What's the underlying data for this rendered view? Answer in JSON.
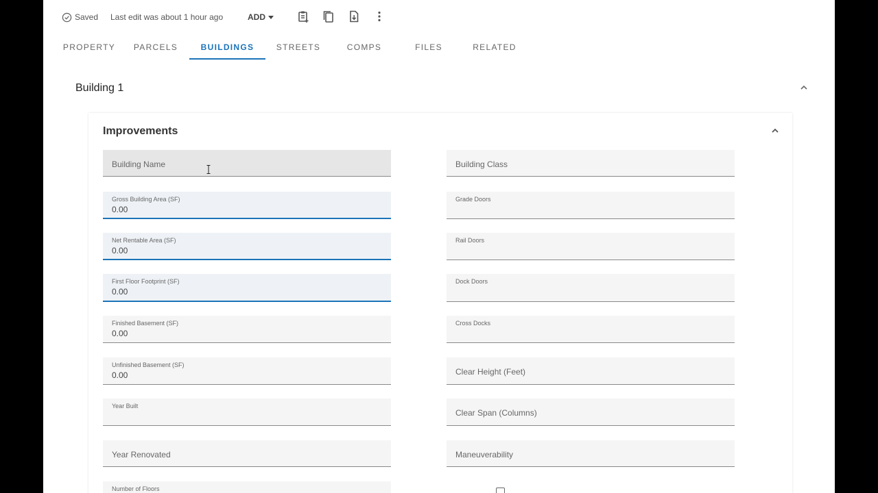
{
  "toolbar": {
    "saved_label": "Saved",
    "last_edit": "Last edit was about 1 hour ago",
    "add_label": "ADD"
  },
  "tabs": [
    {
      "label": "PROPERTY"
    },
    {
      "label": "PARCELS"
    },
    {
      "label": "BUILDINGS",
      "active": true
    },
    {
      "label": "STREETS"
    },
    {
      "label": "COMPS"
    },
    {
      "label": "FILES"
    },
    {
      "label": "RELATED"
    }
  ],
  "building": {
    "title": "Building 1"
  },
  "improvements": {
    "title": "Improvements",
    "left_fields": [
      {
        "label": "Building Name",
        "value": ""
      },
      {
        "label": "Gross Building Area (SF)",
        "value": "0.00"
      },
      {
        "label": "Net Rentable Area (SF)",
        "value": "0.00"
      },
      {
        "label": "First Floor Footprint (SF)",
        "value": "0.00"
      },
      {
        "label": "Finished Basement (SF)",
        "value": "0.00"
      },
      {
        "label": "Unfinished Basement (SF)",
        "value": "0.00"
      },
      {
        "label": "Year Built",
        "value": ""
      },
      {
        "label": "Year Renovated",
        "value": ""
      },
      {
        "label": "Number of Floors",
        "value": ""
      }
    ],
    "right_fields": [
      {
        "label": "Building Class",
        "value": ""
      },
      {
        "label": "Grade Doors",
        "value": ""
      },
      {
        "label": "Rail Doors",
        "value": ""
      },
      {
        "label": "Dock Doors",
        "value": ""
      },
      {
        "label": "Cross Docks",
        "value": ""
      },
      {
        "label": "Clear Height (Feet)",
        "value": ""
      },
      {
        "label": "Clear Span (Columns)",
        "value": ""
      },
      {
        "label": "Maneuverability",
        "value": ""
      }
    ]
  },
  "colors": {
    "accent": "#1a73b8",
    "background": "#ffffff",
    "field_bg": "#f5f5f5"
  },
  "icons": [
    "check-circle-icon",
    "caret-down-icon",
    "clipboard-add-icon",
    "copy-icon",
    "file-download-icon",
    "more-vert-icon",
    "chevron-up-icon"
  ]
}
